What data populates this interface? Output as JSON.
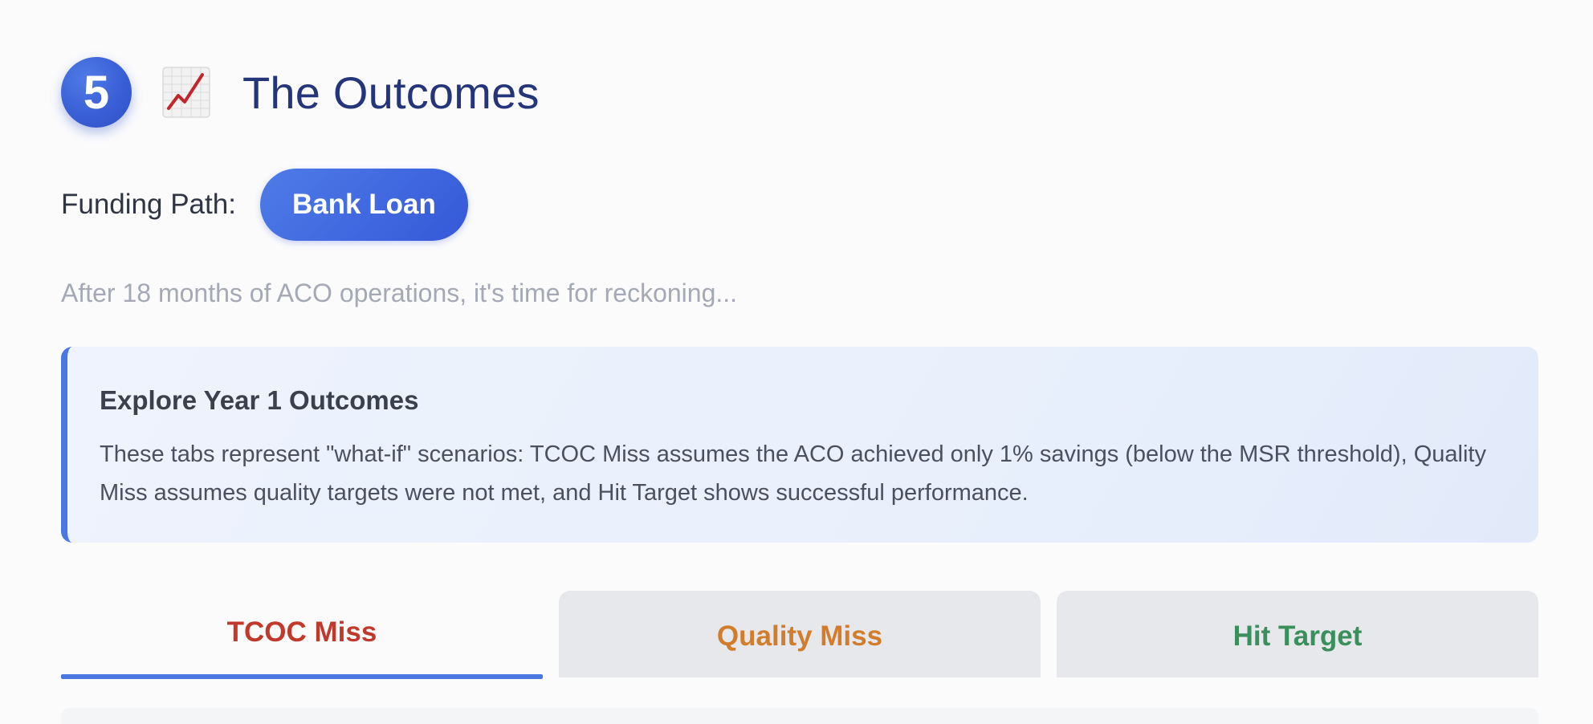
{
  "header": {
    "step_number": "5",
    "icon": "chart-increasing-icon",
    "title": "The Outcomes"
  },
  "funding": {
    "label": "Funding Path:",
    "value": "Bank Loan"
  },
  "intro": "After 18 months of ACO operations, it's time for reckoning...",
  "info": {
    "title": "Explore Year 1 Outcomes",
    "body": "These tabs represent \"what-if\" scenarios: TCOC Miss assumes the ACO achieved only 1% savings (below the MSR threshold), Quality Miss assumes quality targets were not met, and Hit Target shows successful performance."
  },
  "tabs": [
    {
      "label": "TCOC Miss",
      "color": "#c0392b",
      "active": true
    },
    {
      "label": "Quality Miss",
      "color": "#d27d2c",
      "active": false
    },
    {
      "label": "Hit Target",
      "color": "#3b8f5c",
      "active": false
    }
  ],
  "colors": {
    "accent": "#4a78e2",
    "title": "#24357a",
    "badge": "#3a5fd6"
  }
}
